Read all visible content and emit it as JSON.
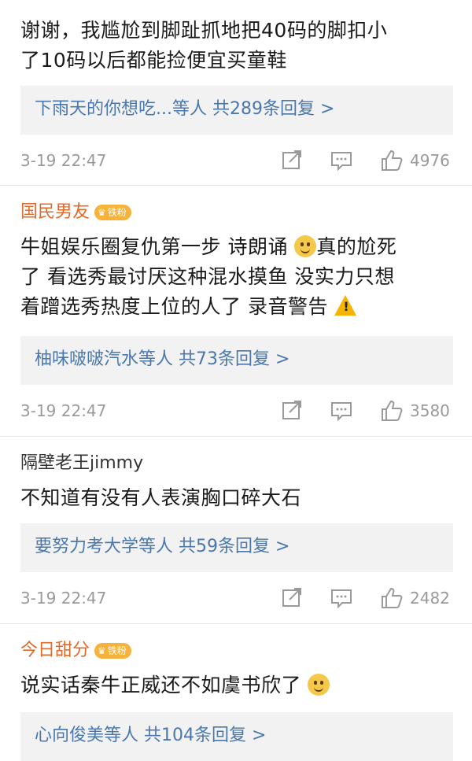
{
  "comments": [
    {
      "author": "",
      "text_lines": [
        "谢谢，我尴尬到脚趾抓地把40码的脚扣小",
        "了10码以后都能捡便宜买童鞋"
      ],
      "reply_summary": "下雨天的你想吃...等人  共289条回复 >",
      "time": "3-19 22:47",
      "likes": "4976"
    },
    {
      "author": "国民男友",
      "badge": "铁粉",
      "text_lines": [
        "牛姐娱乐圈复仇第一步 诗朗诵",
        "了 看选秀最讨厌这种混水摸鱼 没实力只想",
        "着蹭选秀热度上位的人了 录音警告"
      ],
      "text_suffix_line1": "真的尬死",
      "reply_summary": "柚味啵啵汽水等人  共73条回复 >",
      "time": "3-19 22:47",
      "likes": "3580"
    },
    {
      "author": "隔壁老王jimmy",
      "text_lines": [
        "不知道有没有人表演胸口碎大石"
      ],
      "reply_summary": "要努力考大学等人  共59条回复 >",
      "time": "3-19 22:47",
      "likes": "2482"
    },
    {
      "author": "今日甜分",
      "badge": "铁粉",
      "text_lines": [
        "说实话秦牛正威还不如虞书欣了"
      ],
      "reply_summary": "心向俊美等人  共104条回复 >"
    }
  ],
  "colors": {
    "author": "#e06a2a",
    "link": "#4a78ad",
    "meta": "#9a9a9a",
    "reply_bg": "#f2f2f2",
    "badge": "#f7b23b"
  },
  "icons": [
    "share-icon",
    "comment-icon",
    "like-icon",
    "emoji-smile-icon",
    "warning-icon"
  ]
}
